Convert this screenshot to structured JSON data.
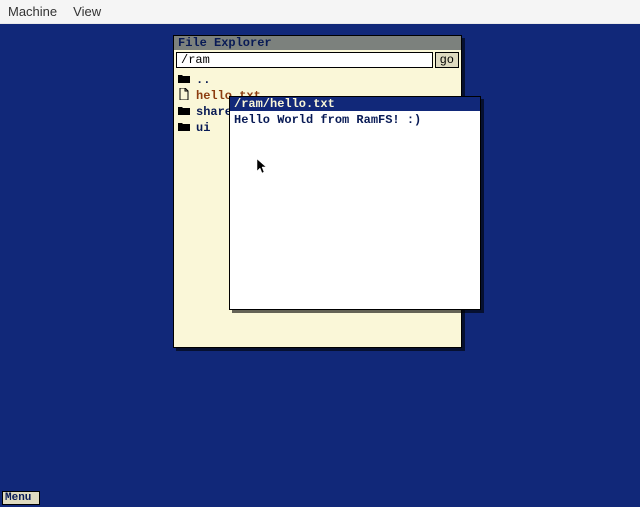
{
  "host": {
    "menu": [
      "Machine",
      "View"
    ]
  },
  "file_explorer": {
    "title": "File Explorer",
    "path": "/ram",
    "go_label": "go",
    "entries": [
      {
        "icon": "folder",
        "name": "..",
        "type": "dir"
      },
      {
        "icon": "file",
        "name": "hello.txt",
        "type": "file"
      },
      {
        "icon": "folder",
        "name": "share",
        "type": "dir"
      },
      {
        "icon": "folder",
        "name": "ui",
        "type": "dir"
      }
    ]
  },
  "viewer": {
    "title": "/ram/hello.txt",
    "content": "Hello World from RamFS! :)"
  },
  "taskbar": {
    "menu_label": "Menu"
  }
}
